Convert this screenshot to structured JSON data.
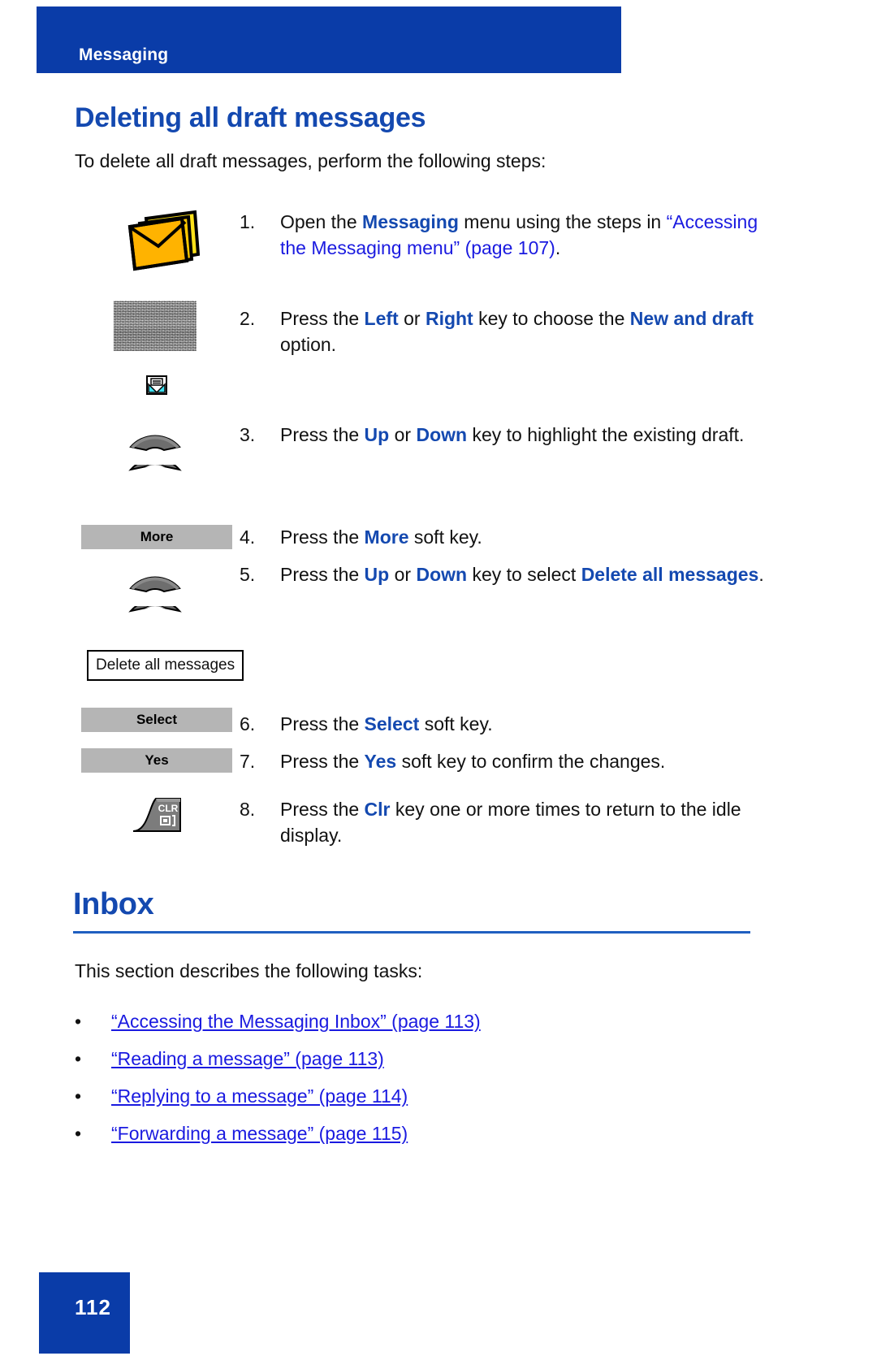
{
  "header": {
    "running_title": "Messaging",
    "bar_color": "#0A3CA8"
  },
  "page": {
    "title": "Deleting all draft messages",
    "intro": "To delete all draft messages, perform the following steps:",
    "heading_color": "#1449B0",
    "link_color": "#1A1AE0",
    "number": "112"
  },
  "steps": [
    {
      "num": "1.",
      "icon": "envelope-stack-icon",
      "text_plain": "Open the Messaging menu using the steps in “Accessing the Messaging menu” (page 107).",
      "lead": "Open the ",
      "keyword": "Messaging",
      "mid": " menu using the steps in ",
      "link": "“Accessing the Messaging menu” (page 107)",
      "tail": "."
    },
    {
      "num": "2.",
      "icon": "scanned-display-image",
      "text_plain": "Press the Left or Right key to choose the New and draft option.",
      "lead": "Press the ",
      "kw1": "Left",
      "mid1": " or ",
      "kw2": "Right",
      "mid2": " key to choose the ",
      "kw3": "New and draft",
      "tail": " option."
    },
    {
      "num": "3.",
      "icon": "navigation-keys-up-down",
      "text_plain": "Press the Up or Down key to highlight the existing draft.",
      "lead": "Press the ",
      "kw1": "Up",
      "mid1": " or ",
      "kw2": "Down",
      "tail": " key to highlight the existing draft."
    },
    {
      "num": "4.",
      "icon": "softkey-more",
      "text_plain": "Press the More soft key.",
      "lead": "Press the ",
      "kw1": "More",
      "tail": " soft key."
    },
    {
      "num": "5.",
      "icon": "navigation-keys-up-down",
      "text_plain": "Press the Up or Down key to select Delete all messages.",
      "lead": "Press the ",
      "kw1": "Up",
      "mid1": " or ",
      "kw2": "Down",
      "mid2": " key to select ",
      "kw3": "Delete all messages",
      "tail": "."
    },
    {
      "num": "6.",
      "icon": "softkey-select",
      "text_plain": "Press the Select soft key.",
      "lead": "Press the ",
      "kw1": "Select",
      "tail": " soft key."
    },
    {
      "num": "7.",
      "icon": "softkey-yes",
      "text_plain": "Press the Yes soft key to confirm the changes.",
      "lead": "Press the ",
      "kw1": "Yes",
      "tail": " soft key to confirm the changes."
    },
    {
      "num": "8.",
      "icon": "clr-key",
      "text_plain": "Press the Clr key one or more times to return to the idle display.",
      "lead": "Press the ",
      "kw1": "Clr",
      "tail": " key one or more times to return to the idle display."
    }
  ],
  "softkeys": {
    "more": "More",
    "select": "Select",
    "yes": "Yes"
  },
  "menu_box": {
    "label": "Delete all messages"
  },
  "clr_key": {
    "label": "CLR"
  },
  "inbox_section": {
    "title": "Inbox",
    "intro": "This section describes the following tasks:",
    "bullet_char": "•",
    "links": [
      "“Accessing the Messaging Inbox” (page 113)",
      "“Reading a message” (page 113)",
      "“Replying to a message” (page 114)",
      "“Forwarding a message” (page 115)"
    ]
  }
}
